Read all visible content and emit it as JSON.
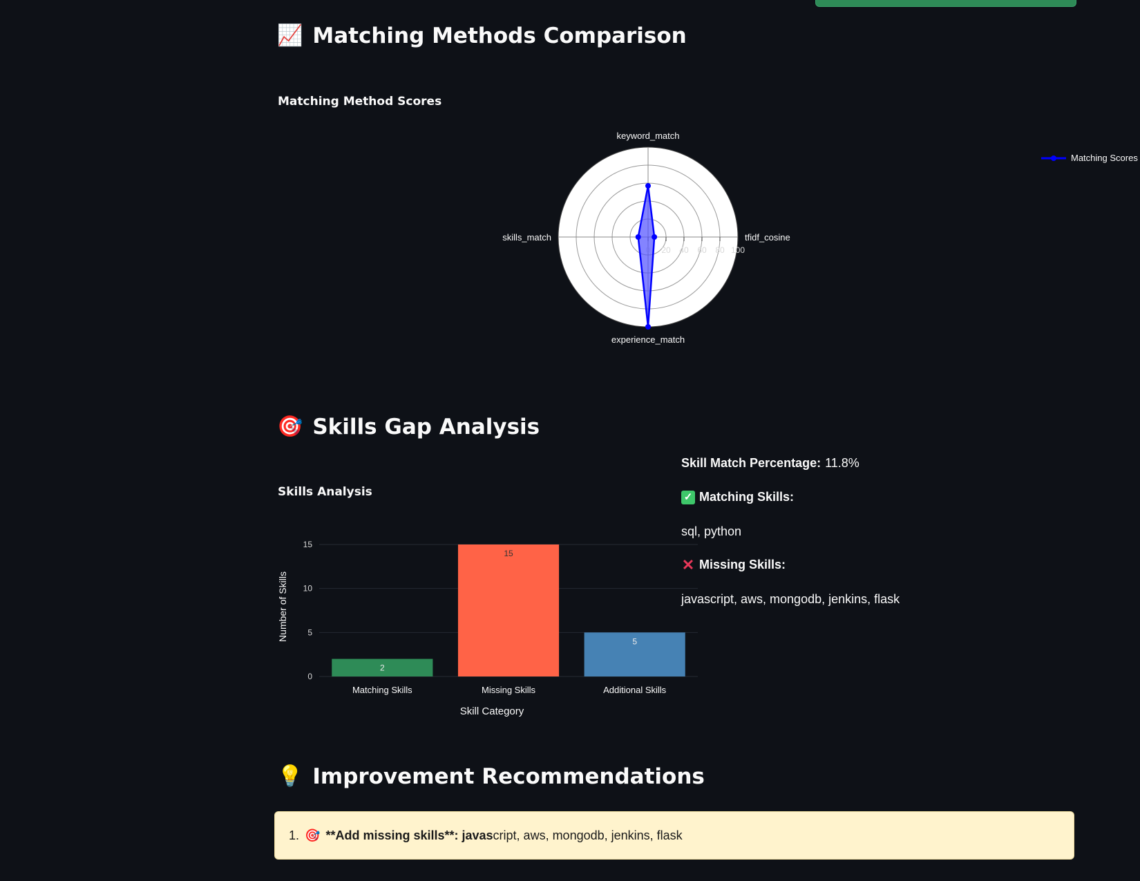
{
  "sections": {
    "matching_methods": {
      "emoji": "📈",
      "title": "Matching Methods Comparison",
      "chart_title": "Matching Method Scores"
    },
    "skills_gap": {
      "emoji": "🎯",
      "title": "Skills Gap Analysis",
      "chart_title": "Skills Analysis"
    },
    "recommendations": {
      "emoji": "💡",
      "title": "Improvement Recommendations"
    }
  },
  "skills_summary": {
    "percentage_label": "Skill Match Percentage:",
    "percentage_value": "11.8%",
    "matching_label": "Matching Skills:",
    "matching_list": "sql, python",
    "missing_label": "Missing Skills:",
    "missing_list": "javascript, aws, mongodb, jenkins, flask"
  },
  "recommendation": {
    "number": "1.",
    "icon": "🎯",
    "bold": "**Add missing skills**: javas",
    "text": "cript, aws, mongodb, jenkins, flask"
  },
  "colors": {
    "radar_line": "#0000ff",
    "radar_fill": "rgba(80,80,255,0.7)",
    "bar_matching": "#2e8b57",
    "bar_missing": "#ff6347",
    "bar_additional": "#4682b4",
    "recommendation_bg": "#fff3cd"
  },
  "chart_data": [
    {
      "type": "radar",
      "axes": [
        "keyword_match",
        "tfidf_cosine",
        "experience_match",
        "skills_match"
      ],
      "radial_ticks": [
        "0",
        "20",
        "40",
        "60",
        "80",
        "100"
      ],
      "range": [
        0,
        100
      ],
      "series": [
        {
          "name": "Matching Scores",
          "values": [
            57,
            7,
            100,
            11
          ]
        }
      ],
      "legend": "top-right"
    },
    {
      "type": "bar",
      "categories": [
        "Matching Skills",
        "Missing Skills",
        "Additional Skills"
      ],
      "values": [
        2,
        15,
        5
      ],
      "value_labels": [
        "2",
        "15",
        "5"
      ],
      "xlabel": "Skill Category",
      "ylabel": "Number of Skills",
      "y_ticks": [
        0,
        5,
        10,
        15
      ],
      "ylim": [
        0,
        15
      ]
    }
  ]
}
